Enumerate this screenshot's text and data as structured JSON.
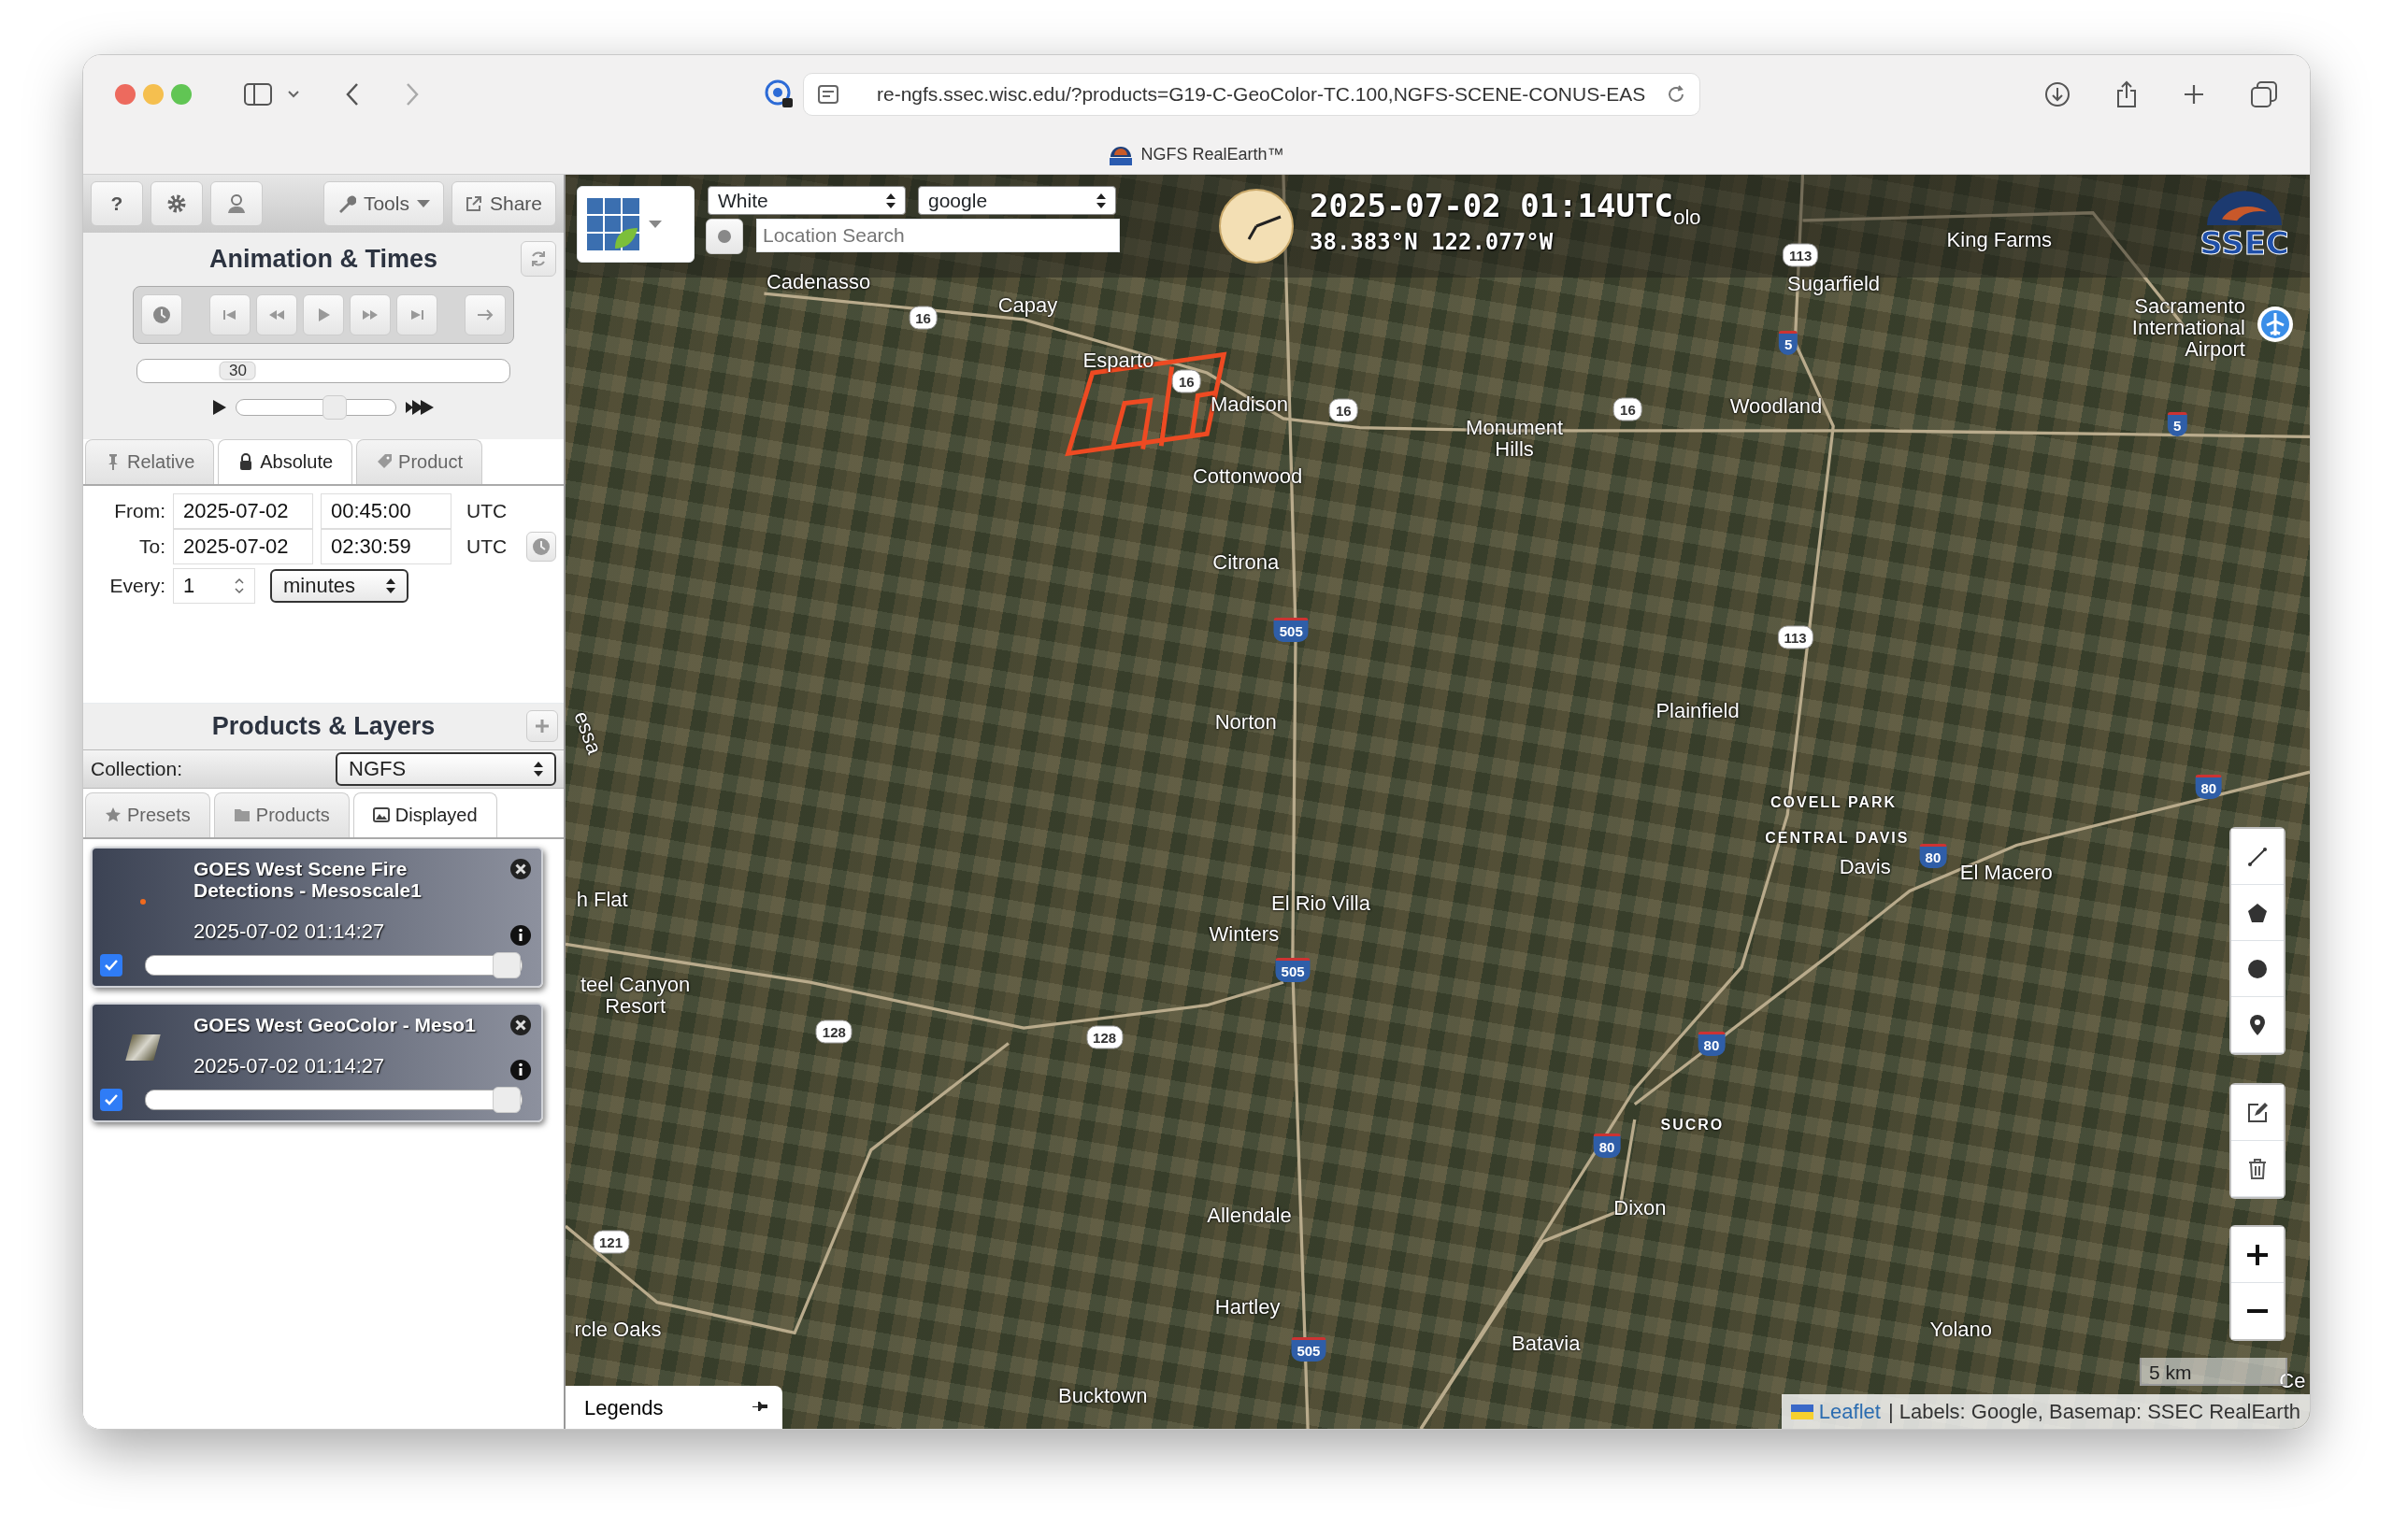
{
  "browser": {
    "url": "re-ngfs.ssec.wisc.edu/?products=G19-C-GeoColor-TC.100,NGFS-SCENE-CONUS-EAS",
    "tab_title": "NGFS RealEarth™"
  },
  "sidebar": {
    "toolbar": {
      "help": "?",
      "tools": "Tools",
      "share": "Share"
    },
    "animation": {
      "title": "Animation & Times",
      "loop_slider": {
        "label": "30",
        "level": 0.27
      },
      "speed_slider": {
        "level": 0.62
      },
      "tabs": [
        {
          "label": "Relative",
          "selected": false,
          "kind": "pin"
        },
        {
          "label": "Absolute",
          "selected": true,
          "kind": "lock"
        },
        {
          "label": "Product",
          "selected": false,
          "kind": "tag"
        }
      ],
      "from": {
        "label": "From:",
        "date": "2025-07-02",
        "time": "00:45:00",
        "zone": "UTC"
      },
      "to": {
        "label": "To:",
        "date": "2025-07-02",
        "time": "02:30:59",
        "zone": "UTC"
      },
      "every": {
        "label": "Every:",
        "value": "1",
        "unit": "minutes"
      }
    },
    "products": {
      "title": "Products & Layers",
      "collection": {
        "label": "Collection:",
        "value": "NGFS"
      },
      "tabs": [
        {
          "label": "Presets",
          "selected": false,
          "kind": "star"
        },
        {
          "label": "Products",
          "selected": false,
          "kind": "folder"
        },
        {
          "label": "Displayed",
          "selected": true,
          "kind": "image"
        }
      ],
      "layers": [
        {
          "title": "GOES West Scene Fire Detections - Mesoscale1",
          "time": "2025-07-02 01:14:27",
          "checked": true,
          "level": 1,
          "kind": "fire"
        },
        {
          "title": "GOES West GeoColor - Meso1",
          "time": "2025-07-02 01:14:27",
          "checked": true,
          "level": 1,
          "kind": "imagery"
        }
      ]
    }
  },
  "map": {
    "basemap": "White",
    "labels": "google",
    "search": {
      "placeholder": "Location Search"
    },
    "time": "2025-07-02 01:14UTC",
    "coords": "38.383°N 122.077°W",
    "logo": "SSEC",
    "places": [
      {
        "name": "Cadenasso",
        "kind": "town"
      },
      {
        "name": "Capay",
        "kind": "town"
      },
      {
        "name": "Esparto",
        "kind": "town"
      },
      {
        "name": "Madison",
        "kind": "town"
      },
      {
        "name": "Cottonwood",
        "kind": "town"
      },
      {
        "name": "Citrona",
        "kind": "town"
      },
      {
        "name": "Monument Hills",
        "kind": "town"
      },
      {
        "name": "Woodland",
        "kind": "town"
      },
      {
        "name": "Sugarfield",
        "kind": "town"
      },
      {
        "name": "King Farms",
        "kind": "town"
      },
      {
        "name": "olo",
        "kind": "town"
      },
      {
        "name": "Sacramento International Airport",
        "kind": "airport"
      },
      {
        "name": "essa",
        "kind": "water"
      },
      {
        "name": "Norton",
        "kind": "town"
      },
      {
        "name": "Plainfield",
        "kind": "town"
      },
      {
        "name": "COVELL PARK",
        "kind": "district"
      },
      {
        "name": "CENTRAL DAVIS",
        "kind": "district"
      },
      {
        "name": "Davis",
        "kind": "town"
      },
      {
        "name": "El Macero",
        "kind": "town"
      },
      {
        "name": "h Flat",
        "kind": "town"
      },
      {
        "name": "El Rio Villa",
        "kind": "town"
      },
      {
        "name": "Winters",
        "kind": "town"
      },
      {
        "name": "teel Canyon Resort",
        "kind": "town"
      },
      {
        "name": "SUCRO",
        "kind": "district"
      },
      {
        "name": "Allendale",
        "kind": "town"
      },
      {
        "name": "Dixon",
        "kind": "town"
      },
      {
        "name": "Hartley",
        "kind": "town"
      },
      {
        "name": "Batavia",
        "kind": "town"
      },
      {
        "name": "Yolano",
        "kind": "town"
      },
      {
        "name": "rcle Oaks",
        "kind": "town"
      },
      {
        "name": "Bucktown",
        "kind": "town"
      },
      {
        "name": "Ce",
        "kind": "town"
      }
    ],
    "shields": [
      {
        "label": "16",
        "kind": "state"
      },
      {
        "label": "16",
        "kind": "state"
      },
      {
        "label": "16",
        "kind": "state"
      },
      {
        "label": "16",
        "kind": "state"
      },
      {
        "label": "113",
        "kind": "state"
      },
      {
        "label": "5",
        "kind": "interstate"
      },
      {
        "label": "5",
        "kind": "interstate"
      },
      {
        "label": "505",
        "kind": "interstate"
      },
      {
        "label": "113",
        "kind": "state"
      },
      {
        "label": "80",
        "kind": "interstate"
      },
      {
        "label": "80",
        "kind": "interstate"
      },
      {
        "label": "505",
        "kind": "interstate"
      },
      {
        "label": "128",
        "kind": "state"
      },
      {
        "label": "128",
        "kind": "state"
      },
      {
        "label": "80",
        "kind": "interstate"
      },
      {
        "label": "80",
        "kind": "interstate"
      },
      {
        "label": "121",
        "kind": "state"
      },
      {
        "label": "505",
        "kind": "interstate"
      }
    ],
    "scale": "5 km",
    "legends": "Legends",
    "attribution": {
      "link": "Leaflet",
      "text": "| Labels: Google, Basemap: SSEC RealEarth"
    }
  }
}
